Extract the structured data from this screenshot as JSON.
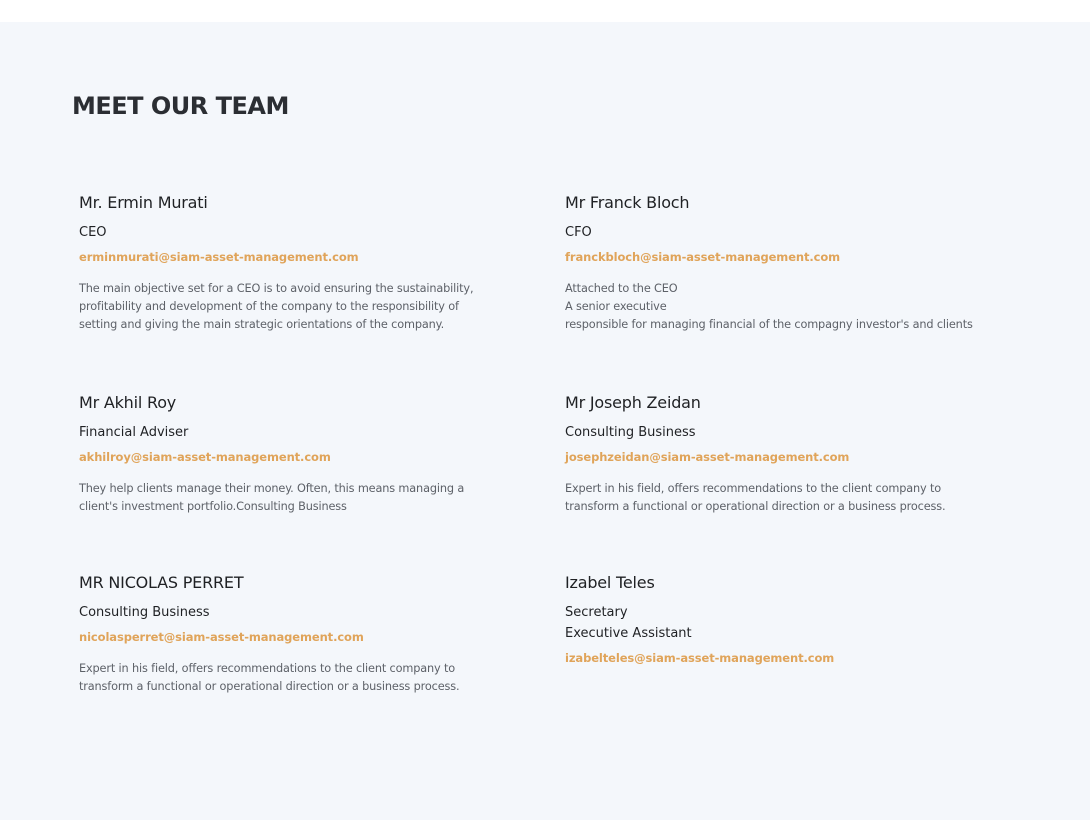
{
  "page": {
    "heading": "MEET OUR TEAM",
    "accent_color": "#e0a45a",
    "background_color": "#f4f7fb"
  },
  "team": [
    {
      "name": "Mr. Ermin Murati",
      "role": "CEO",
      "email": "erminmurati@siam-asset-management.com",
      "description": "The main objective set for a CEO is to avoid ensuring the sustainability,\nprofitability and development of the company to the responsibility of\nsetting and giving the main strategic orientations of the company."
    },
    {
      "name": "Mr Franck Bloch",
      "role": "CFO",
      "email": "franckbloch@siam-asset-management.com",
      "description": "Attached to the CEO\nA senior executive\nresponsible for managing financial of the compagny investor's and clients"
    },
    {
      "name": "Mr Akhil Roy",
      "role": "Financial Adviser",
      "email": "akhilroy@siam-asset-management.com",
      "description": "They help clients manage their money. Often, this means managing a\nclient's investment portfolio.Consulting Business"
    },
    {
      "name": "Mr Joseph Zeidan",
      "role": "Consulting Business",
      "email": "josephzeidan@siam-asset-management.com",
      "description": "Expert in his field, offers recommendations to the client company to\ntransform a functional or operational direction or a business process."
    },
    {
      "name": "MR NICOLAS PERRET",
      "role": "Consulting Business",
      "email": "nicolasperret@siam-asset-management.com",
      "description": "Expert in his field, offers recommendations to the client company to\ntransform a functional or operational direction or a business process."
    },
    {
      "name": "Izabel Teles",
      "role": "Secretary",
      "role_secondary": "Executive Assistant",
      "email": "izabelteles@siam-asset-management.com"
    }
  ]
}
